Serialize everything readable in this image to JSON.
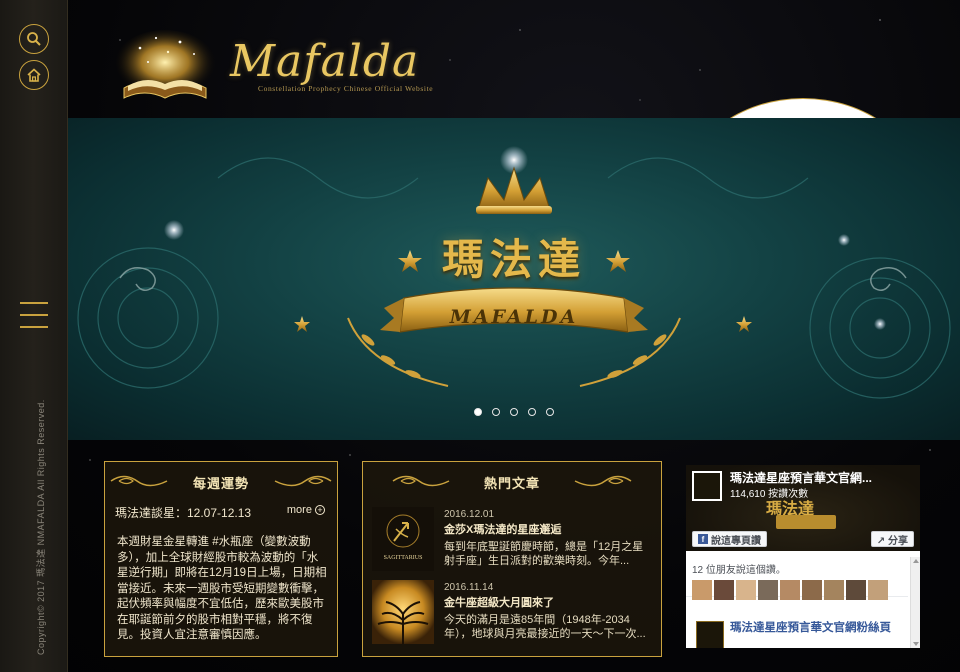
{
  "sidebar": {
    "search_icon": "search-icon",
    "home_icon": "home-icon",
    "facebook_icon": "facebook-icon",
    "facebook_label": "f",
    "menu_icon": "hamburger-menu-icon",
    "copyright": "Copyright© 2017 瑪法達  NMAFALDA All Rights Reserved."
  },
  "header": {
    "logo_word": "Mafalda",
    "logo_subtitle": "Constellation Prophecy Chinese Official Website"
  },
  "hero": {
    "title": "瑪法達",
    "ribbon": "MAFALDA",
    "slides": 5,
    "active_slide": 1
  },
  "weekly": {
    "heading": "每週運勢",
    "date_line": "瑪法達談星：12.07-12.13",
    "more_label": "more",
    "body": "本週財星金星轉進 #水瓶座（變數波動多），加上全球財經股市較為波動的「水星逆行期」即將在12月19日上場，日期相當接近。未來一週股市受短期變數衝擊，起伏頻率與幅度不宜低估，歷來歐美股市在耶誕節前夕的股市相對平穩，將不復見。投資人宜注意審慎因應。"
  },
  "hot": {
    "heading": "熱門文章",
    "articles": [
      {
        "date": "2016.12.01",
        "title": "金莎X瑪法達的星座邂逅",
        "excerpt": "每到年底聖誕節慶時節，總是「12月之星射手座」生日派對的歡樂時刻。今年...",
        "thumb_label": "SAGITTARIUS"
      },
      {
        "date": "2016.11.14",
        "title": "金牛座超級大月圓來了",
        "excerpt": "今天的滿月是遠85年間（1948年-2034年），地球與月亮最接近的一天～下一次..."
      }
    ]
  },
  "facebook": {
    "page_name": "瑪法達星座預言華文官網...",
    "likes": "114,610 按讚次數",
    "cover_word": "瑪法達",
    "like_button": "說這專頁讚",
    "share_button": "分享",
    "friends_text": "12 位朋友說這個讚。",
    "post_title": "瑪法達星座預言華文官網粉絲頁"
  },
  "colors": {
    "gold": "#c9a23e",
    "teal_banner": "#134244",
    "panel_bg": "#1c160c",
    "fb_blue": "#3b5998"
  }
}
